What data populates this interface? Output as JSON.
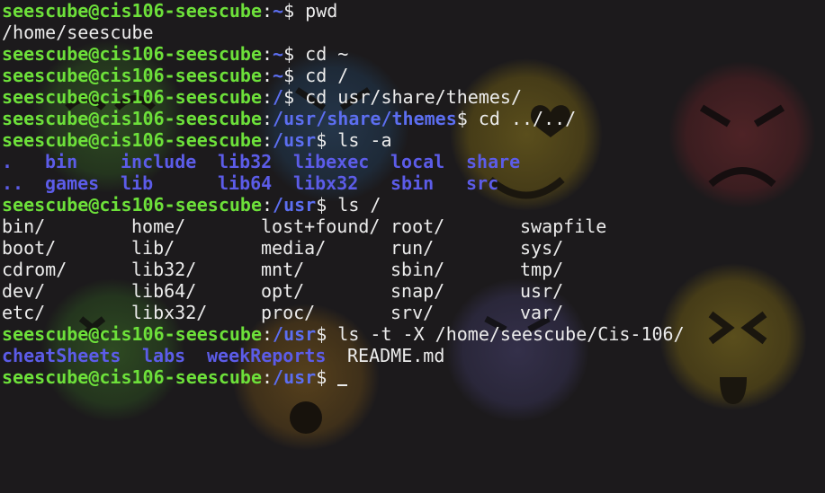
{
  "terminal": {
    "colors": {
      "prompt_user": "#6de03a",
      "prompt_path": "#5c6ef0",
      "directory": "#5c5ce8",
      "text": "#ececec",
      "background": "#1c1a1c"
    },
    "prompt_user": "seescube@cis106-seescube",
    "lines": [
      {
        "type": "prompt",
        "path": "~",
        "command": "pwd"
      },
      {
        "type": "output",
        "text": "/home/seescube"
      },
      {
        "type": "prompt",
        "path": "~",
        "command": "cd ~"
      },
      {
        "type": "prompt",
        "path": "~",
        "command": "cd /"
      },
      {
        "type": "prompt",
        "path": "/",
        "command": "cd usr/share/themes/"
      },
      {
        "type": "prompt",
        "path": "/usr/share/themes",
        "command": "cd ../../"
      },
      {
        "type": "prompt",
        "path": "/usr",
        "command": "ls -a"
      },
      {
        "type": "dirs",
        "items": [
          ".",
          "bin",
          "include",
          "lib32",
          "libexec",
          "local",
          "share"
        ]
      },
      {
        "type": "dirs",
        "items": [
          "..",
          "games",
          "lib",
          "lib64",
          "libx32",
          "sbin",
          "src"
        ]
      },
      {
        "type": "prompt",
        "path": "/usr",
        "command": "ls /"
      },
      {
        "type": "output",
        "items": [
          "bin/",
          "home/",
          "lost+found/",
          "root/",
          "swapfile"
        ]
      },
      {
        "type": "output",
        "items": [
          "boot/",
          "lib/",
          "media/",
          "run/",
          "sys/"
        ]
      },
      {
        "type": "output",
        "items": [
          "cdrom/",
          "lib32/",
          "mnt/",
          "sbin/",
          "tmp/"
        ]
      },
      {
        "type": "output",
        "items": [
          "dev/",
          "lib64/",
          "opt/",
          "snap/",
          "usr/"
        ]
      },
      {
        "type": "output",
        "items": [
          "etc/",
          "libx32/",
          "proc/",
          "srv/",
          "var/"
        ]
      },
      {
        "type": "prompt",
        "path": "/usr",
        "command": "ls -t -X /home/seescube/Cis-106/"
      },
      {
        "type": "mixed",
        "dirs": [
          "cheatSheets",
          "labs",
          "weekReports"
        ],
        "files": [
          "README.md"
        ]
      },
      {
        "type": "prompt",
        "path": "/usr",
        "command": ""
      }
    ]
  },
  "wallpaper": {
    "icons": [
      "grinning-face-icon",
      "heart-eyes-face-icon",
      "angry-face-icon",
      "sleeping-face-icon",
      "dizzy-face-icon",
      "shocked-face-icon",
      "sad-face-icon",
      "tongue-out-face-icon"
    ]
  }
}
